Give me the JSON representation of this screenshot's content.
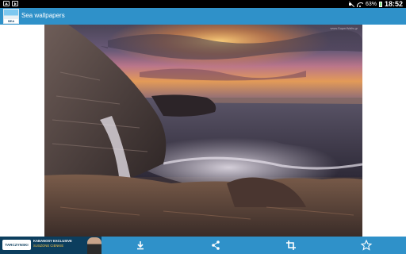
{
  "status_bar": {
    "left_icons": [
      "photo-icon",
      "video-icon"
    ],
    "mute_icon": "mute-icon",
    "wifi_icon": "wifi-icon",
    "battery_percent": "63%",
    "time": "18:52"
  },
  "app_bar": {
    "title": "Sea wallpapers",
    "icon_label": "SEA",
    "color": "#2f91c9"
  },
  "wallpaper": {
    "watermark": "www.SuperWalls.gr"
  },
  "ad": {
    "logo": "TARCZYNSKI",
    "headline": "KABANOSY EXCLUSIVE",
    "subtext": "SUSZONE CIENKIE"
  },
  "toolbar": {
    "actions": [
      {
        "name": "download",
        "icon": "download-icon"
      },
      {
        "name": "share",
        "icon": "share-icon"
      },
      {
        "name": "crop",
        "icon": "crop-icon"
      },
      {
        "name": "favorite",
        "icon": "star-icon"
      }
    ]
  }
}
